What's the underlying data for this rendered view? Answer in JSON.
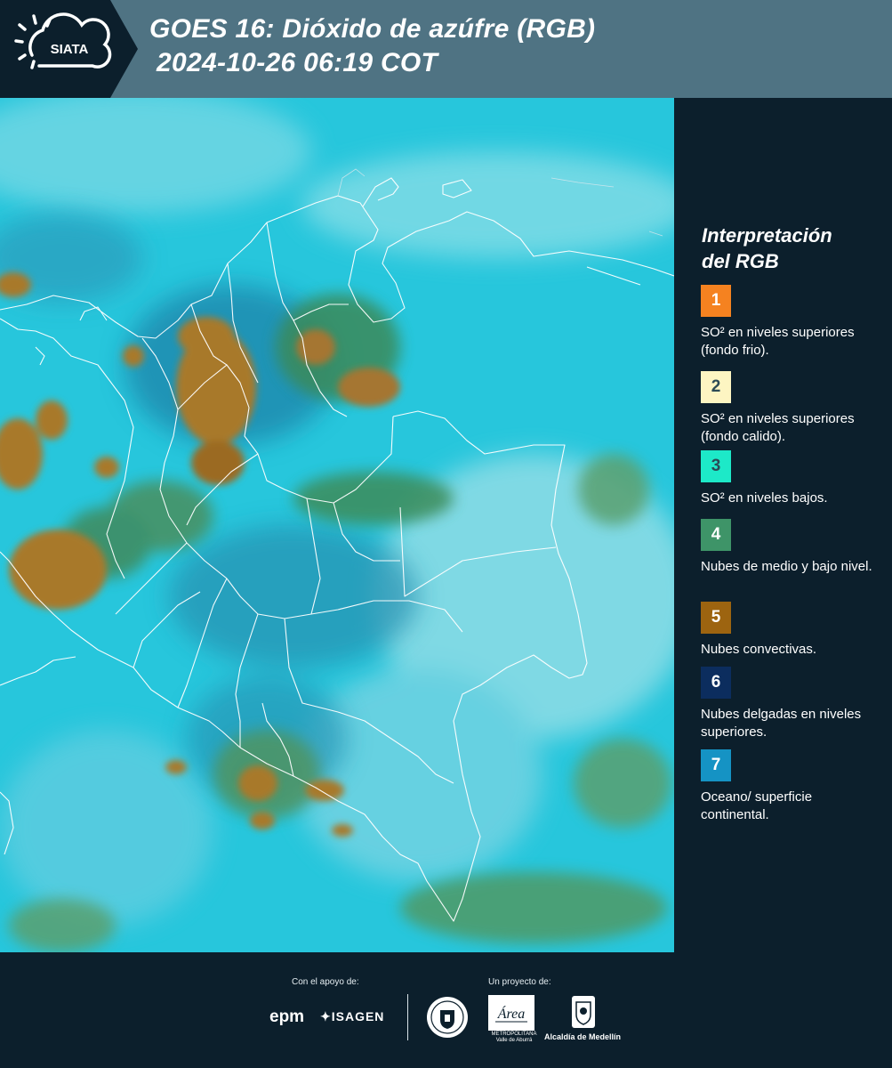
{
  "header": {
    "logo_text": "SIATA",
    "title_line1": "GOES 16: Dióxido de azúfre (RGB)",
    "title_line2": "2024-10-26 06:19 COT"
  },
  "legend": {
    "title_line1": "Interpretación",
    "title_line2": "del RGB",
    "items": [
      {
        "num": "1",
        "label": "SO² en niveles superiores (fondo frio).",
        "color": "#f58220"
      },
      {
        "num": "2",
        "label": "SO² en niveles superiores (fondo calido).",
        "color": "#fdf5c2"
      },
      {
        "num": "3",
        "label": "SO² en niveles bajos.",
        "color": "#1de9c8"
      },
      {
        "num": "4",
        "label": "Nubes de medio y bajo nivel.",
        "color": "#3e9468"
      },
      {
        "num": "5",
        "label": "Nubes convectivas.",
        "color": "#9d6410"
      },
      {
        "num": "6",
        "label": "Nubes delgadas en niveles superiores.",
        "color": "#0c2d5e"
      },
      {
        "num": "7",
        "label": "Oceano/ superficie continental.",
        "color": "#1593c4"
      }
    ]
  },
  "footer": {
    "support_label": "Con el apoyo de:",
    "project_label": "Un proyecto de:",
    "epm": "epm",
    "isagen": "ISAGEN",
    "area_name": "Área",
    "area_sub1": "METROPOLITANA",
    "area_sub2": "Valle de Aburrá",
    "alcaldia": "Alcaldía de Medellín"
  }
}
